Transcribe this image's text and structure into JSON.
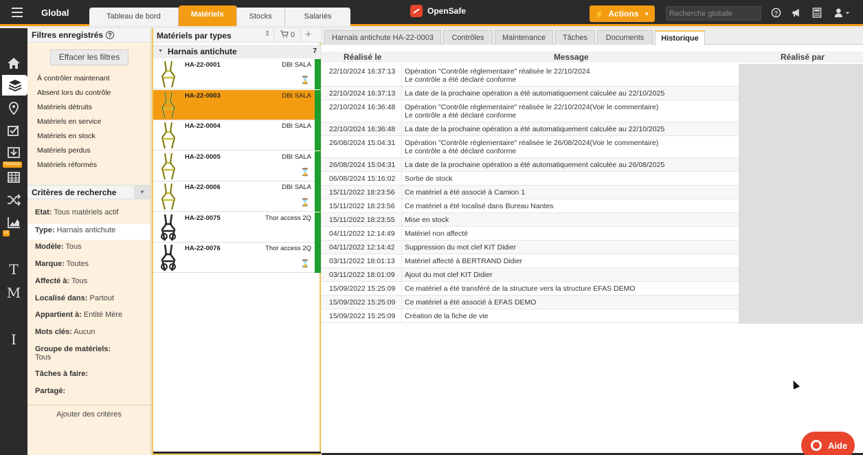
{
  "top": {
    "global_label": "Global",
    "tabs": [
      {
        "label": "Tableau de bord"
      },
      {
        "label": "Matériels",
        "active": true
      },
      {
        "label": "Stocks"
      },
      {
        "label": "Salariés"
      }
    ],
    "brand": "OpenSafe",
    "actions_label": "Actions",
    "search_placeholder": "Recherche globale",
    "icons": [
      "help-icon",
      "megaphone-icon",
      "calculator-icon",
      "user-icon"
    ]
  },
  "rail": {
    "items": [
      "home-icon",
      "layers-icon",
      "map-pin-icon",
      "checklist-icon",
      "download-icon",
      "calendar-icon",
      "shuffle-icon",
      "chart-icon"
    ],
    "badge_new": "Nouveau",
    "badge_v2": "v2",
    "letters": [
      "T",
      "M",
      "I"
    ],
    "accent": "#f39c12"
  },
  "filters": {
    "saved_title": "Filtres enregistrés",
    "clear_label": "Effacer les filtres",
    "saved": [
      "À contrôler maintenant",
      "Absent lors du contrôle",
      "Matériels détruits",
      "Matériels en service",
      "Matériels en stock",
      "Matériels perdus",
      "Matériels réformés"
    ],
    "criteria_title": "Critères de recherche",
    "criteria": [
      {
        "label": "Etat:",
        "value": "Tous matériels actif"
      },
      {
        "label": "Type:",
        "value": "Harnais antichute"
      },
      {
        "label": "Modèle:",
        "value": "Tous"
      },
      {
        "label": "Marque:",
        "value": "Toutes"
      },
      {
        "label": "Affecté à:",
        "value": "Tous"
      },
      {
        "label": "Localisé dans:",
        "value": "Partout"
      },
      {
        "label": "Appartient à:",
        "value": "Entité Mère"
      },
      {
        "label": "Mots clés:",
        "value": "Aucun"
      },
      {
        "label": "Groupe de matériels:",
        "value": "Tous"
      },
      {
        "label": "Tâches à faire:",
        "value": ""
      },
      {
        "label": "Partagé:",
        "value": ""
      }
    ],
    "add_criteria": "Ajouter des critères"
  },
  "list": {
    "title": "Matériels par types",
    "cart_count": "0",
    "group_name": "Harnais antichute",
    "group_count": "7",
    "items": [
      {
        "code": "HA-22-0001",
        "brand": "DBI SALA",
        "hourglass": true
      },
      {
        "code": "HA-22-0003",
        "brand": "DBI SALA",
        "hourglass": false,
        "selected": true
      },
      {
        "code": "HA-22-0004",
        "brand": "DBI SALA",
        "hourglass": false
      },
      {
        "code": "HA-22-0005",
        "brand": "DBI SALA",
        "hourglass": true
      },
      {
        "code": "HA-22-0006",
        "brand": "DBI SALA",
        "hourglass": true
      },
      {
        "code": "HA-22-0075",
        "brand": "Thor access 2Q",
        "hourglass": false
      },
      {
        "code": "HA-22-0076",
        "brand": "Thor access 2Q",
        "hourglass": true
      }
    ],
    "status_color": "#1e9e2d"
  },
  "detail": {
    "tabs": [
      "Harnais antichute HA-22-0003",
      "Contrôles",
      "Maintenance",
      "Tâches",
      "Documents",
      "Historique"
    ],
    "active_tab": "Historique",
    "columns": [
      "Réalisé le",
      "Message",
      "Réalisé par"
    ],
    "rows": [
      {
        "date": "22/10/2024 16:37:13",
        "lines": [
          "Opération \"Contrôle réglementaire\" réalisée le 22/10/2024",
          "Le contrôle a été déclaré conforme"
        ]
      },
      {
        "date": "22/10/2024 16:37:13",
        "lines": [
          "La date de la prochaine opération a été automatiquement calculée au 22/10/2025"
        ]
      },
      {
        "date": "22/10/2024 16:36:48",
        "lines": [
          "Opération \"Contrôle réglementaire\" réalisée le 22/10/2024(Voir le commentaire)",
          "Le contrôle a été déclaré conforme"
        ]
      },
      {
        "date": "22/10/2024 16:36:48",
        "lines": [
          "La date de la prochaine opération a été automatiquement calculée au 22/10/2025"
        ]
      },
      {
        "date": "26/08/2024 15:04:31",
        "lines": [
          "Opération \"Contrôle réglementaire\" réalisée le 26/08/2024(Voir le commentaire)",
          "Le contrôle a été déclaré conforme"
        ]
      },
      {
        "date": "26/08/2024 15:04:31",
        "lines": [
          "La date de la prochaine opération a été automatiquement calculée au 26/08/2025"
        ]
      },
      {
        "date": "06/08/2024 15:16:02",
        "lines": [
          "Sortie de stock"
        ]
      },
      {
        "date": "15/11/2022 18:23:56",
        "lines": [
          "Ce matériel a été associé à Camion 1"
        ]
      },
      {
        "date": "15/11/2022 18:23:56",
        "lines": [
          "Ce matériel a été localisé dans Bureau Nantes"
        ]
      },
      {
        "date": "15/11/2022 18:23:55",
        "lines": [
          "Mise en stock"
        ]
      },
      {
        "date": "04/11/2022 12:14:49",
        "lines": [
          "Matériel non affecté"
        ]
      },
      {
        "date": "04/11/2022 12:14:42",
        "lines": [
          "Suppression du mot clef KIT Didier"
        ]
      },
      {
        "date": "03/11/2022 18:01:13",
        "lines": [
          "Matériel affecté à BERTRAND Didier"
        ]
      },
      {
        "date": "03/11/2022 18:01:09",
        "lines": [
          "Ajout du mot clef KIT Didier"
        ]
      },
      {
        "date": "15/09/2022 15:25:09",
        "lines": [
          "Ce matériel a été transféré de la structure vers la structure EFAS DEMO"
        ]
      },
      {
        "date": "15/09/2022 15:25:09",
        "lines": [
          "Ce matériel a été associé à EFAS DEMO"
        ]
      },
      {
        "date": "15/09/2022 15:25:09",
        "lines": [
          "Création de la fiche de vie"
        ]
      }
    ]
  },
  "aide_label": "Aide"
}
